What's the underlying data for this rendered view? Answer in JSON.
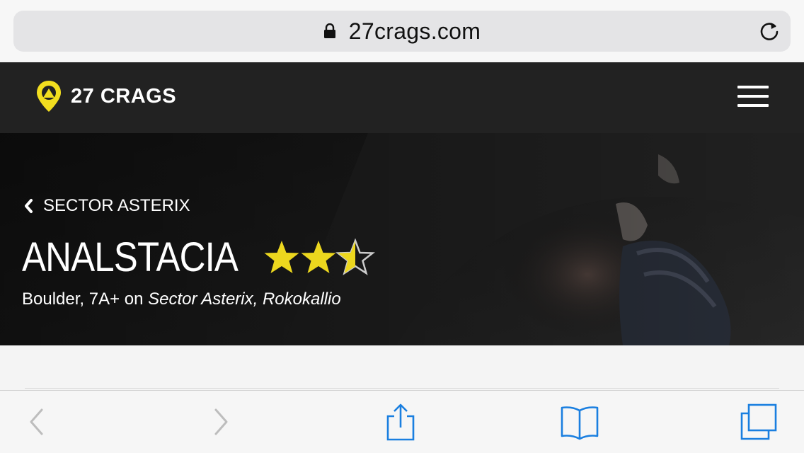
{
  "browser": {
    "url": "27crags.com"
  },
  "site": {
    "logo_text": "27 CRAGS"
  },
  "hero": {
    "back_label": "SECTOR ASTERIX",
    "route_name": "ANALSTACIA",
    "rating": 2.5,
    "rating_max": 3,
    "subtitle_prefix": "Boulder, 7A+ on ",
    "subtitle_location": "Sector Asterix, Rokokallio"
  },
  "colors": {
    "star": "#ecd71e",
    "brand": "#f2de1f",
    "toolbar_icon": "#1a7fe0",
    "toolbar_disabled": "#bdbdbd"
  },
  "toolbar": {
    "icons": [
      "back-arrow-icon",
      "forward-arrow-icon",
      "share-icon",
      "bookmarks-icon",
      "tabs-icon"
    ]
  }
}
